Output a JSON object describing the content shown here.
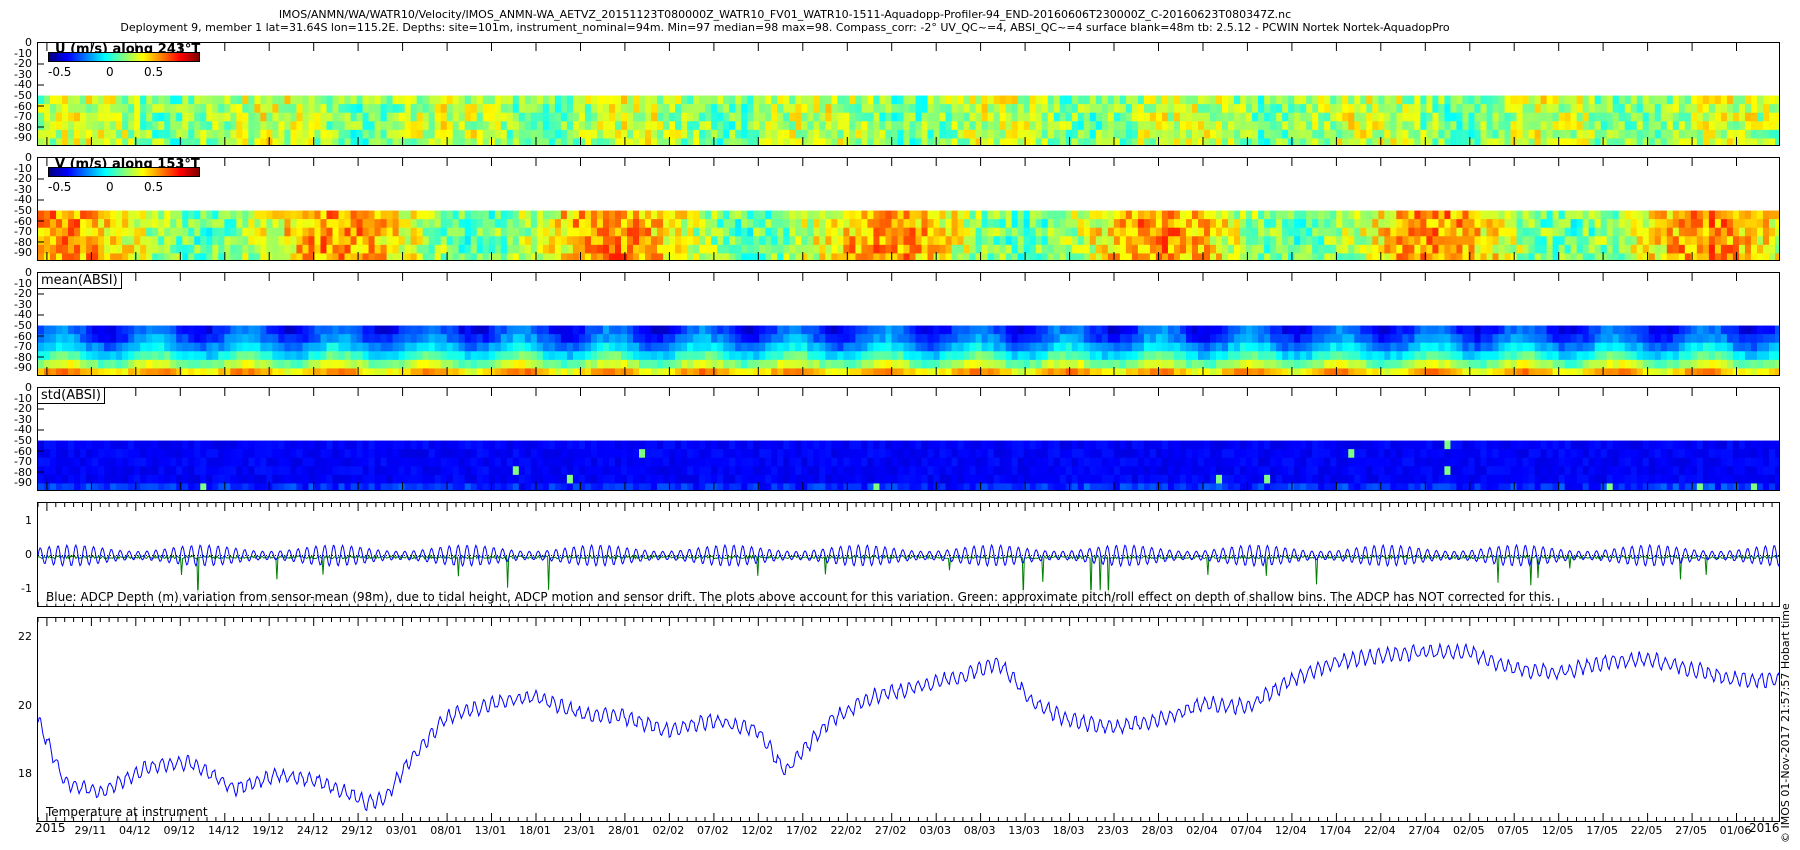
{
  "header": {
    "line1": "IMOS/ANMN/WA/WATR10/Velocity/IMOS_ANMN-WA_AETVZ_20151123T080000Z_WATR10_FV01_WATR10-1511-Aquadopp-Profiler-94_END-20160606T230000Z_C-20160623T080347Z.nc",
    "line2": "Deployment 9, member 1 lat=31.64S lon=115.2E. Depths: site=101m, instrument_nominal=94m. Min=97 median=98 max=98. Compass_corr: -2° UV_QC~=4, ABSI_QC~=4 surface blank=48m tb: 2.5.12 - PCWIN Nortek Nortek-AquadopPro"
  },
  "stamp": "© IMOS 01-Nov-2017 21:57:57 Hobart time",
  "depth_ticks": [
    "0",
    "-10",
    "-20",
    "-30",
    "-40",
    "-50",
    "-60",
    "-70",
    "-80",
    "-90"
  ],
  "colorbar_ticks": [
    "-0.5",
    "0",
    "0.5"
  ],
  "panels": {
    "u": {
      "title": "U (m/s) along 243°T"
    },
    "v": {
      "title": "V (m/s) along 153°T"
    },
    "mean": {
      "title": "mean(ABSI)"
    },
    "std": {
      "title": "std(ABSI)"
    },
    "depth": {
      "note": "Blue: ADCP Depth (m) variation from sensor-mean (98m), due to tidal height, ADCP motion and sensor drift. The plots above account for this variation. Green: approximate pitch/roll effect on depth of shallow bins. The ADCP has NOT corrected for this.",
      "yticks": [
        "1",
        "0",
        "-1"
      ]
    },
    "temp": {
      "note": "Temperature at instrument",
      "yticks": [
        "22",
        "20",
        "18"
      ]
    }
  },
  "xaxis": {
    "labels": [
      "29/11",
      "04/12",
      "09/12",
      "14/12",
      "19/12",
      "24/12",
      "29/12",
      "03/01",
      "08/01",
      "13/01",
      "18/01",
      "23/01",
      "28/01",
      "02/02",
      "07/02",
      "12/02",
      "17/02",
      "22/02",
      "27/02",
      "03/03",
      "08/03",
      "13/03",
      "18/03",
      "23/03",
      "28/03",
      "02/04",
      "07/04",
      "12/04",
      "17/04",
      "22/04",
      "27/04",
      "02/05",
      "07/05",
      "12/05",
      "17/05",
      "22/05",
      "27/05",
      "01/06"
    ],
    "year_start": "2015",
    "year_end": "2016"
  },
  "colors": {
    "depth_line": "#0000ff",
    "pitch_line": "#007f00",
    "temp_line": "#0000ff"
  },
  "chart_data": [
    {
      "type": "heatmap",
      "title": "U (m/s) along 243°T",
      "x_range": [
        "2015-11-23",
        "2016-06-06"
      ],
      "ylim": [
        -95,
        0
      ],
      "data_depth_range": [
        -95,
        -48
      ],
      "colorbar": {
        "min": -0.75,
        "max": 0.75,
        "ticks": [
          -0.5,
          0,
          0.5
        ]
      },
      "typical_value": 0.05
    },
    {
      "type": "heatmap",
      "title": "V (m/s) along 153°T",
      "x_range": [
        "2015-11-23",
        "2016-06-06"
      ],
      "ylim": [
        -95,
        0
      ],
      "data_depth_range": [
        -95,
        -48
      ],
      "colorbar": {
        "min": -0.75,
        "max": 0.75,
        "ticks": [
          -0.5,
          0,
          0.5
        ]
      },
      "typical_value": 0.15
    },
    {
      "type": "heatmap",
      "title": "mean(ABSI)",
      "x_range": [
        "2015-11-23",
        "2016-06-06"
      ],
      "ylim": [
        -95,
        0
      ],
      "data_depth_range": [
        -95,
        -48
      ]
    },
    {
      "type": "heatmap",
      "title": "std(ABSI)",
      "x_range": [
        "2015-11-23",
        "2016-06-06"
      ],
      "ylim": [
        -95,
        0
      ],
      "data_depth_range": [
        -95,
        -48
      ]
    },
    {
      "type": "line",
      "x_range": [
        "2015-11-23",
        "2016-06-06"
      ],
      "ylim": [
        -1.5,
        1.5
      ],
      "series": [
        {
          "tidal_amplitude": 0.3,
          "tidal_period_days": 1.0
        },
        {
          "typical_level": -0.05,
          "spike_min": -1.45
        }
      ]
    },
    {
      "type": "line",
      "x_range": [
        "2015-11-23",
        "2016-06-06"
      ],
      "ylim": [
        16.8,
        22.8
      ],
      "series": [
        {
          "x": [
            "2015-11-23",
            "2015-11-26",
            "2015-11-30",
            "2015-12-05",
            "2015-12-10",
            "2015-12-15",
            "2015-12-20",
            "2015-12-25",
            "2015-12-30",
            "2016-01-01",
            "2016-01-04",
            "2016-01-08",
            "2016-01-13",
            "2016-01-18",
            "2016-01-23",
            "2016-01-28",
            "2016-02-02",
            "2016-02-07",
            "2016-02-12",
            "2016-02-15",
            "2016-02-20",
            "2016-02-25",
            "2016-03-01",
            "2016-03-06",
            "2016-03-10",
            "2016-03-14",
            "2016-03-18",
            "2016-03-23",
            "2016-03-28",
            "2016-04-02",
            "2016-04-07",
            "2016-04-12",
            "2016-04-17",
            "2016-04-22",
            "2016-04-27",
            "2016-05-02",
            "2016-05-07",
            "2016-05-12",
            "2016-05-17",
            "2016-05-22",
            "2016-05-27",
            "2016-06-01",
            "2016-06-06"
          ],
          "values": [
            19.8,
            18.0,
            17.7,
            18.4,
            18.6,
            17.8,
            18.2,
            18.0,
            17.4,
            17.5,
            18.7,
            19.9,
            20.3,
            20.5,
            20.0,
            19.9,
            19.5,
            19.8,
            19.5,
            18.3,
            19.8,
            20.5,
            20.8,
            21.1,
            21.5,
            20.3,
            19.8,
            19.6,
            19.8,
            20.3,
            20.2,
            21.0,
            21.5,
            21.7,
            21.8,
            21.8,
            21.3,
            21.2,
            21.5,
            21.6,
            21.3,
            21.0,
            21.0
          ]
        }
      ]
    }
  ]
}
